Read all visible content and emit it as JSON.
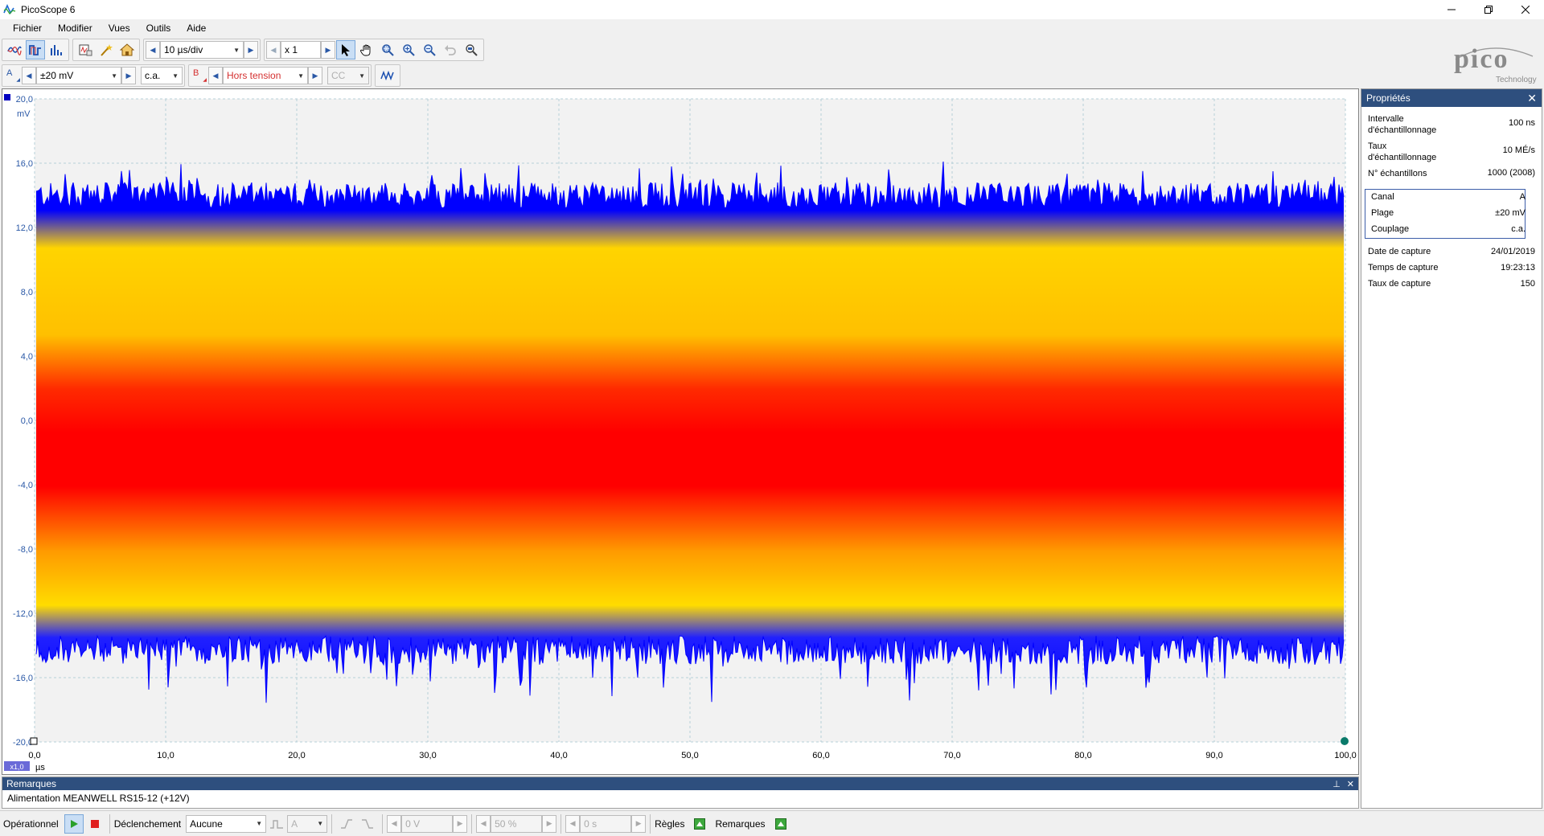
{
  "window": {
    "title": "PicoScope 6"
  },
  "menu": [
    "Fichier",
    "Modifier",
    "Vues",
    "Outils",
    "Aide"
  ],
  "toolbar": {
    "timebase": "10 µs/div",
    "zoom": "x 1"
  },
  "channels": {
    "a": {
      "label": "A",
      "range": "±20 mV",
      "coupling": "c.a."
    },
    "b": {
      "label": "B",
      "range": "Hors tension",
      "coupling": "CC"
    }
  },
  "logo": {
    "text": "pico",
    "sub": "Technology"
  },
  "scope": {
    "y_unit": "mV",
    "x_unit": "µs",
    "zoom_badge": "x1,0",
    "y_ticks": [
      "20,0",
      "16,0",
      "12,0",
      "8,0",
      "4,0",
      "0,0",
      "-4,0",
      "-8,0",
      "-12,0",
      "-16,0",
      "-20,0"
    ],
    "x_ticks": [
      "0,0",
      "10,0",
      "20,0",
      "30,0",
      "40,0",
      "50,0",
      "60,0",
      "70,0",
      "80,0",
      "90,0",
      "100,0"
    ],
    "colors": {
      "outer": "#0000ff",
      "mid": "#ffd000",
      "core": "#ff0000",
      "grid": "#b7d0d8",
      "plot_bg": "#f2f2f2"
    }
  },
  "properties": {
    "title": "Propriétés",
    "rows": [
      {
        "label": "Intervalle d'échantillonnage",
        "value": "100 ns"
      },
      {
        "label": "Taux d'échantillonnage",
        "value": "10 MÉ/s"
      },
      {
        "label": "N° échantillons",
        "value": "1000  (2008)"
      }
    ],
    "channel_rows": [
      {
        "label": "Canal",
        "value": "A"
      },
      {
        "label": "Plage",
        "value": "±20 mV"
      },
      {
        "label": "Couplage",
        "value": "c.a."
      }
    ],
    "capture_rows": [
      {
        "label": "Date de capture",
        "value": "24/01/2019"
      },
      {
        "label": "Temps de capture",
        "value": "19:23:13"
      },
      {
        "label": "Taux de capture",
        "value": "150"
      }
    ]
  },
  "notes": {
    "title": "Remarques",
    "text": "Alimentation MEANWELL RS15-12 (+12V)"
  },
  "statusbar": {
    "mode": "Opérationnel",
    "trigger_label": "Déclenchement",
    "trigger_value": "Aucune",
    "trigger_channel": "A",
    "level": "0 V",
    "pretrigger": "50 %",
    "delay": "0 s",
    "rules": "Règles",
    "remarks": "Remarques"
  }
}
